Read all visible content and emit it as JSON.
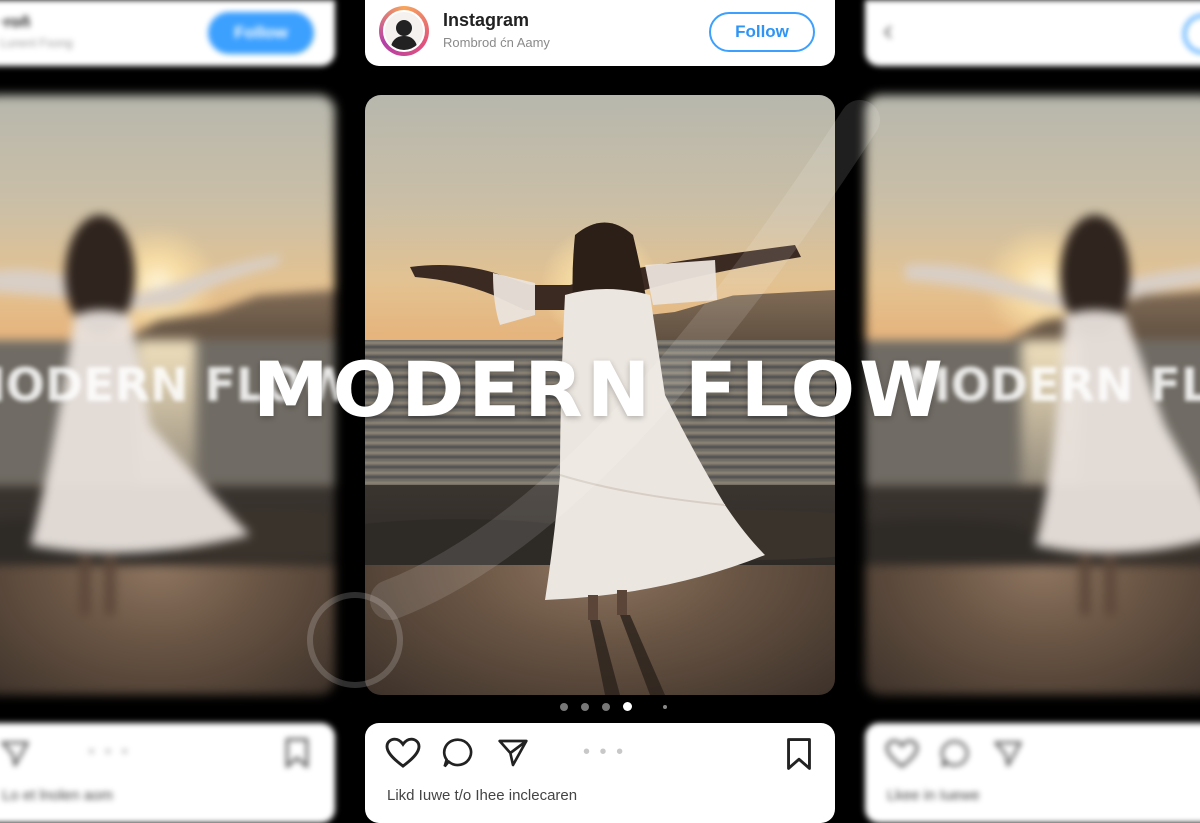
{
  "center_post": {
    "account_name": "Instagram",
    "account_sub": "Rombrod ćn Aamy",
    "follow_label": "Follow",
    "likes_text": "Likd Iuwe t/o Ihee inclecaren"
  },
  "left_post": {
    "account_name": "∙roñ",
    "account_sub": "Lunenl Fsong",
    "follow_label": "Follow",
    "likes_text": "Lo et lnolen aom"
  },
  "right_post": {
    "likes_text": "Lkee in Iuewe"
  },
  "overlay_title": "MODERN FLOW",
  "carousel": {
    "total": 5,
    "active_index": 3
  },
  "icons": [
    "heart-icon",
    "comment-icon",
    "share-icon",
    "more-icon",
    "bookmark-icon",
    "back-chevron-icon"
  ],
  "colors": {
    "accent": "#3ca0ff",
    "background": "#000000"
  }
}
